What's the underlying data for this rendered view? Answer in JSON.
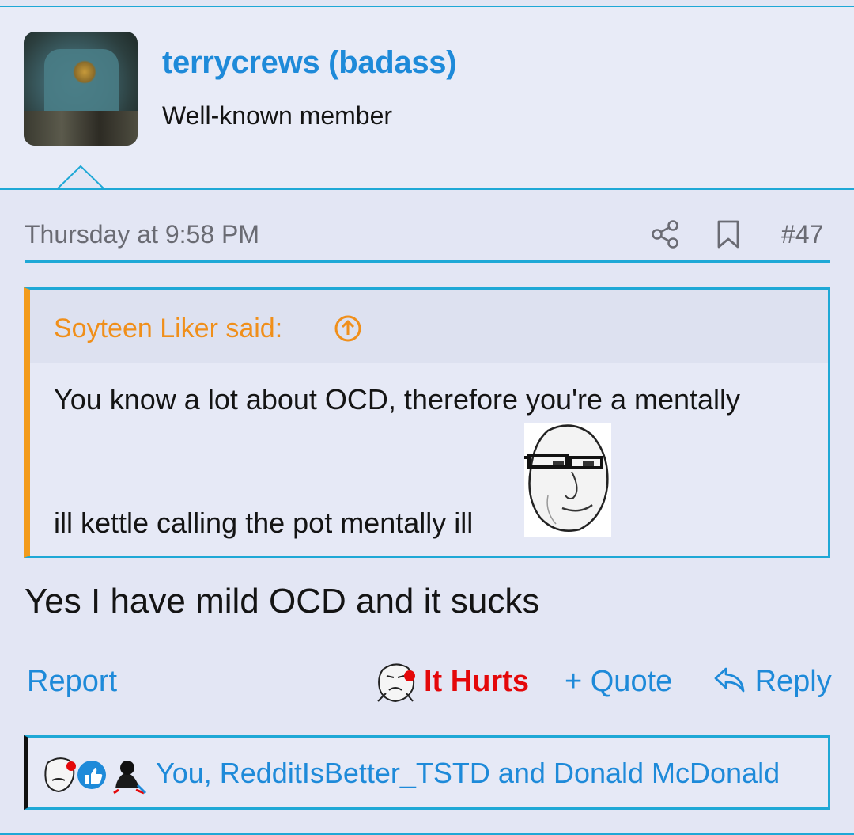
{
  "user": {
    "name": "terrycrews (badass)",
    "title": "Well-known member"
  },
  "post": {
    "date": "Thursday at 9:58 PM",
    "number": "#47",
    "quote": {
      "author": "Soyteen Liker said:",
      "line1": "You know a lot about OCD, therefore you're a mentally",
      "line2": "ill kettle calling the pot mentally ill"
    },
    "body": "Yes I have mild OCD and it sucks"
  },
  "actions": {
    "report": "Report",
    "reaction": "It Hurts",
    "quote": "+ Quote",
    "reply": "Reply"
  },
  "reactions_bar": {
    "names": "You, RedditIsBetter_TSTD and Donald McDonald"
  },
  "colors": {
    "accent": "#1fa8d6",
    "link": "#1e8ad9",
    "quote_author": "#f08f1a",
    "reaction_red": "#e4080a"
  }
}
